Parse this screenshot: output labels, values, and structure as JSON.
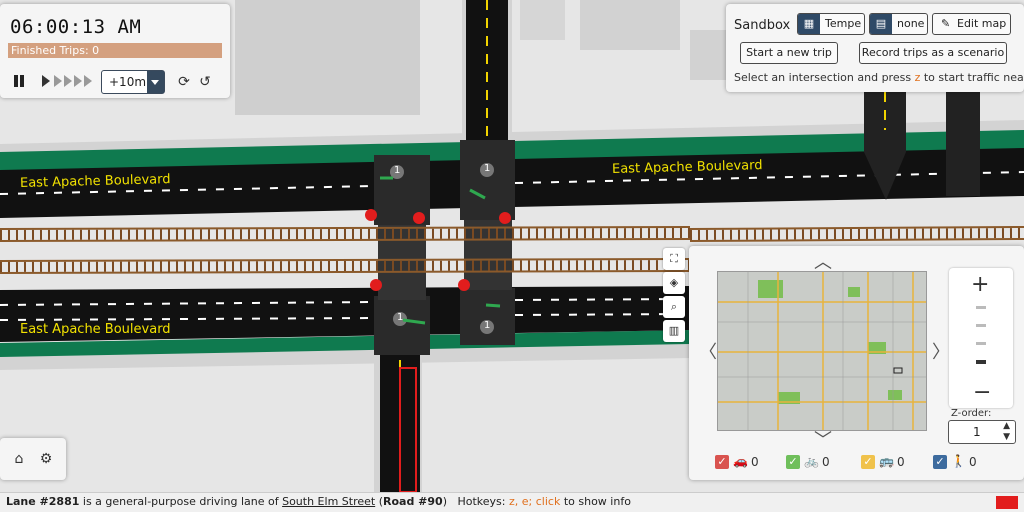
{
  "time_panel": {
    "clock": "06:00:13 AM",
    "finished_trips": "Finished Trips: 0",
    "jump_label": "+10m"
  },
  "sandbox": {
    "title": "Sandbox",
    "map_btn": "Tempe",
    "scenario_btn": "none",
    "edit_map_btn": "Edit map",
    "start_trip_btn": "Start a new trip",
    "record_btn": "Record trips as a scenario",
    "instruction_pre": "Select an intersection and press ",
    "instruction_key": "z",
    "instruction_post": " to start traffic nearby"
  },
  "map": {
    "road_labels": [
      "East Apache Boulevard",
      "East Apache Boulevard",
      "East Apache Boulevard"
    ],
    "signal_numbers": [
      "1",
      "1",
      "1",
      "1"
    ]
  },
  "minimap": {
    "z_order_label": "Z-order:",
    "z_order_value": "1",
    "layers": [
      {
        "name": "car-icon",
        "count": "0",
        "color": "#d9534f"
      },
      {
        "name": "bike-icon",
        "count": "0",
        "color": "#6fbf5b"
      },
      {
        "name": "bus-icon",
        "count": "0",
        "color": "#f0c24b"
      },
      {
        "name": "pedestrian-icon",
        "count": "0",
        "color": "#3d6b9e"
      }
    ]
  },
  "status": {
    "lane": "Lane #2881",
    "text1": " is a general-purpose driving lane of ",
    "street": "South Elm Street",
    "road_open": " (",
    "road": "Road #90",
    "road_close": ")",
    "hotkeys_label": "Hotkeys: ",
    "hotkeys_keys": "z, e; click",
    "hotkeys_tail": " to show info"
  },
  "colors": {
    "road": "#111111",
    "sidewalk": "#d8d8d8",
    "bike_lane": "#0f7a4f",
    "rail": "#8b5a2b",
    "status_swatch": "#e21d1d"
  }
}
